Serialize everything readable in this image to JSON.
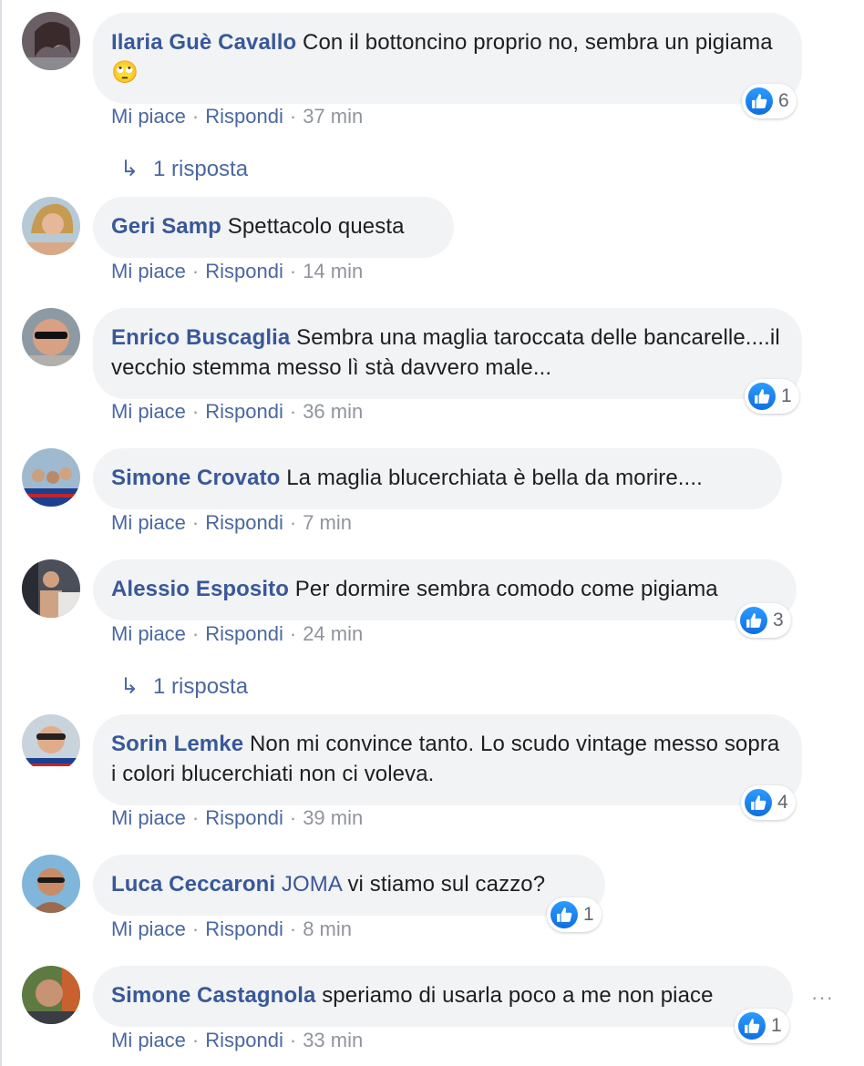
{
  "comments": [
    {
      "author": "Ilaria Guè Cavallo",
      "text": "Con il bottoncino proprio no, sembra un pigiama",
      "emoji": "🙄",
      "likes": "6",
      "time": "37 min",
      "replies": "1 risposta"
    },
    {
      "author": "Geri Samp",
      "text": "Spettacolo questa",
      "time": "14 min"
    },
    {
      "author": "Enrico Buscaglia",
      "text": "Sembra una maglia taroccata delle bancarelle....il vecchio stemma messo lì stà davvero male...",
      "likes": "1",
      "time": "36 min"
    },
    {
      "author": "Simone Crovato",
      "text": "La maglia blucerchiata è bella da morire....",
      "time": "7 min"
    },
    {
      "author": "Alessio Esposito",
      "text": "Per dormire sembra comodo come pigiama",
      "likes": "3",
      "time": "24 min",
      "replies": "1 risposta"
    },
    {
      "author": "Sorin Lemke",
      "text": "Non mi convince tanto. Lo scudo vintage messo sopra i colori blucerchiati non ci voleva.",
      "likes": "4",
      "time": "39 min"
    },
    {
      "author": "Luca Ceccaroni",
      "mention": "JOMA",
      "text": "vi stiamo sul cazzo?",
      "likes": "1",
      "time": "8 min"
    },
    {
      "author": "Simone Castagnola",
      "text": "speriamo di usarla poco a me non piace",
      "likes": "1",
      "time": "33 min",
      "more": "···"
    }
  ],
  "labels": {
    "like": "Mi piace",
    "reply": "Rispondi",
    "separator": "·",
    "reply_arrow": "↳"
  },
  "icons": {
    "like": "thumbs-up-icon",
    "reply_arrow": "reply-arrow-icon",
    "more": "more-options-icon"
  },
  "colors": {
    "author": "#385898",
    "bubble": "#f2f3f5",
    "like_blue": "#1877f2",
    "meta_gray": "#90949c"
  }
}
